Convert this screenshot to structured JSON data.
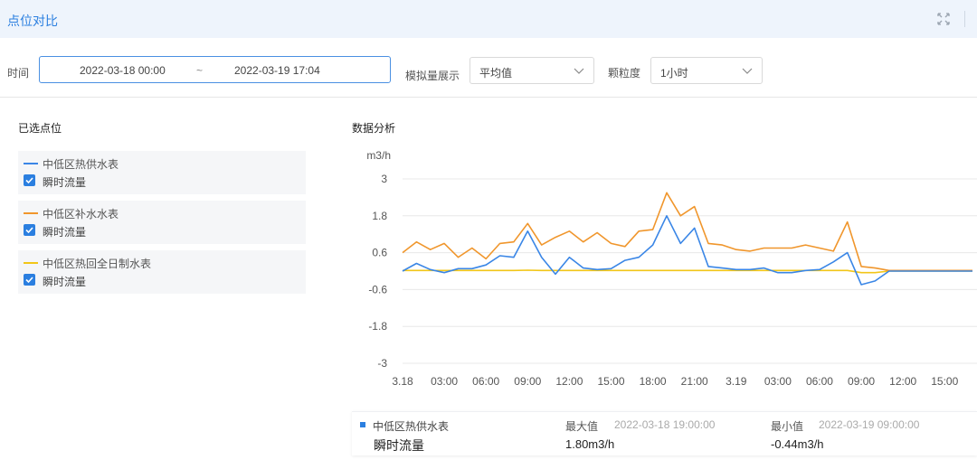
{
  "page": {
    "title": "点位对比"
  },
  "filters": {
    "time_label": "时间",
    "start": "2022-03-18 00:00",
    "range_sep": "~",
    "end": "2022-03-19 17:04",
    "analog_label": "模拟量展示",
    "analog_value": "平均值",
    "granularity_label": "颗粒度",
    "granularity_value": "1小时"
  },
  "selected": {
    "title": "已选点位",
    "points": [
      {
        "name": "中低区热供水表",
        "metric": "瞬时流量",
        "color": "#3a86e6",
        "checked": true
      },
      {
        "name": "中低区补水水表",
        "metric": "瞬时流量",
        "color": "#f0962c",
        "checked": true
      },
      {
        "name": "中低区热回全日制水表",
        "metric": "瞬时流量",
        "color": "#f2c618",
        "checked": true
      }
    ]
  },
  "analysis": {
    "title": "数据分析"
  },
  "chart_data": {
    "type": "line",
    "ylabel": "m3/h",
    "ylim": [
      -3,
      3
    ],
    "yticks": [
      3,
      1.8,
      0.6,
      -0.6,
      -1.8,
      -3
    ],
    "xtick_labels": [
      "3.18",
      "03:00",
      "06:00",
      "09:00",
      "12:00",
      "15:00",
      "18:00",
      "21:00",
      "3.19",
      "03:00",
      "06:00",
      "09:00",
      "12:00",
      "15:00"
    ],
    "grid": true,
    "x": [
      "3.18 00:00",
      "3.18 01:00",
      "3.18 02:00",
      "3.18 03:00",
      "3.18 04:00",
      "3.18 05:00",
      "3.18 06:00",
      "3.18 07:00",
      "3.18 08:00",
      "3.18 09:00",
      "3.18 10:00",
      "3.18 11:00",
      "3.18 12:00",
      "3.18 13:00",
      "3.18 14:00",
      "3.18 15:00",
      "3.18 16:00",
      "3.18 17:00",
      "3.18 18:00",
      "3.18 19:00",
      "3.18 20:00",
      "3.18 21:00",
      "3.18 22:00",
      "3.18 23:00",
      "3.19 00:00",
      "3.19 01:00",
      "3.19 02:00",
      "3.19 03:00",
      "3.19 04:00",
      "3.19 05:00",
      "3.19 06:00",
      "3.19 07:00",
      "3.19 08:00",
      "3.19 09:00",
      "3.19 10:00",
      "3.19 11:00",
      "3.19 12:00",
      "3.19 13:00",
      "3.19 14:00",
      "3.19 15:00",
      "3.19 16:00",
      "3.19 17:00"
    ],
    "series": [
      {
        "name": "中低区热供水表",
        "color": "#3a86e6",
        "values": [
          0.0,
          0.25,
          0.05,
          -0.05,
          0.08,
          0.08,
          0.2,
          0.5,
          0.45,
          1.3,
          0.45,
          -0.1,
          0.45,
          0.1,
          0.05,
          0.08,
          0.35,
          0.45,
          0.85,
          1.8,
          0.9,
          1.4,
          0.15,
          0.1,
          0.05,
          0.05,
          0.1,
          -0.05,
          -0.05,
          0.02,
          0.05,
          0.3,
          0.6,
          -0.44,
          -0.32,
          0.0,
          0.0,
          0.0,
          0.0,
          0.0,
          0.0,
          0.0
        ]
      },
      {
        "name": "中低区补水水表",
        "color": "#f0962c",
        "values": [
          0.6,
          0.95,
          0.7,
          0.9,
          0.45,
          0.75,
          0.4,
          0.9,
          0.95,
          1.55,
          0.85,
          1.1,
          1.3,
          0.95,
          1.25,
          0.9,
          0.8,
          1.3,
          1.35,
          2.55,
          1.8,
          2.1,
          0.9,
          0.85,
          0.7,
          0.65,
          0.75,
          0.75,
          0.75,
          0.85,
          0.75,
          0.65,
          1.6,
          0.15,
          0.1,
          0.02,
          0.02,
          0.02,
          0.02,
          0.02,
          0.02,
          0.02
        ]
      },
      {
        "name": "中低区热回全日制水表",
        "color": "#f2c618",
        "values": [
          0.02,
          0.02,
          0.02,
          0.02,
          0.02,
          0.02,
          0.02,
          0.02,
          0.02,
          0.03,
          0.02,
          0.02,
          0.02,
          0.02,
          0.02,
          0.02,
          0.02,
          0.02,
          0.02,
          0.02,
          0.02,
          0.02,
          0.02,
          0.02,
          0.02,
          0.02,
          0.02,
          0.02,
          0.02,
          0.02,
          0.02,
          0.02,
          0.02,
          -0.05,
          -0.05,
          0.0,
          0.0,
          0.0,
          0.0,
          0.0,
          0.0,
          0.0
        ]
      }
    ]
  },
  "summary": {
    "point": "中低区热供水表",
    "metric": "瞬时流量",
    "max_label": "最大值",
    "max_time": "2022-03-18 19:00:00",
    "max_value": "1.80m3/h",
    "min_label": "最小值",
    "min_time": "2022-03-19 09:00:00",
    "min_value": "-0.44m3/h"
  }
}
